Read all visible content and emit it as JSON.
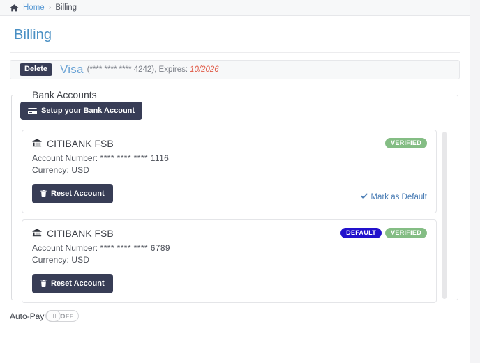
{
  "breadcrumb": {
    "home_icon": "home-icon",
    "home_label": "Home",
    "separator": "›",
    "current_label": "Billing"
  },
  "page": {
    "title": "Billing"
  },
  "credit_card": {
    "delete_label": "Delete",
    "brand": "Visa",
    "mask": "(**** **** **** 4242), Expires:",
    "expiry": "10/2026",
    "expiry_color": "#e05a47",
    "brand_color": "#6aa3d5"
  },
  "bank_section": {
    "legend": "Bank Accounts",
    "setup_button_label": "Setup your Bank Account",
    "setup_button_icon": "credit-card-icon",
    "accounts": [
      {
        "bank_icon": "bank-icon",
        "bank_name": "CITIBANK FSB",
        "account_number_label": "Account Number:",
        "account_number_mask": "**** **** **** 1116",
        "currency_label": "Currency:",
        "currency_value": "USD",
        "reset_button_label": "Reset Account",
        "reset_button_icon": "trash-icon",
        "badges": [
          "VERIFIED"
        ],
        "mark_default_label": "Mark as Default",
        "mark_default_icon": "check-icon",
        "show_mark_default": true
      },
      {
        "bank_icon": "bank-icon",
        "bank_name": "CITIBANK FSB",
        "account_number_label": "Account Number:",
        "account_number_mask": "**** **** **** 6789",
        "currency_label": "Currency:",
        "currency_value": "USD",
        "reset_button_label": "Reset Account",
        "reset_button_icon": "trash-icon",
        "badges": [
          "DEFAULT",
          "VERIFIED"
        ],
        "mark_default_label": "",
        "mark_default_icon": "check-icon",
        "show_mark_default": false
      }
    ]
  },
  "autopay": {
    "label": "Auto-Pay",
    "state_text": "OFF",
    "enabled": false
  },
  "colors": {
    "dark_button": "#383d56",
    "badge_verified": "#84bd84",
    "badge_default": "#2211cc",
    "link_blue": "#5b9bd5",
    "title_blue": "#4a90c4"
  }
}
